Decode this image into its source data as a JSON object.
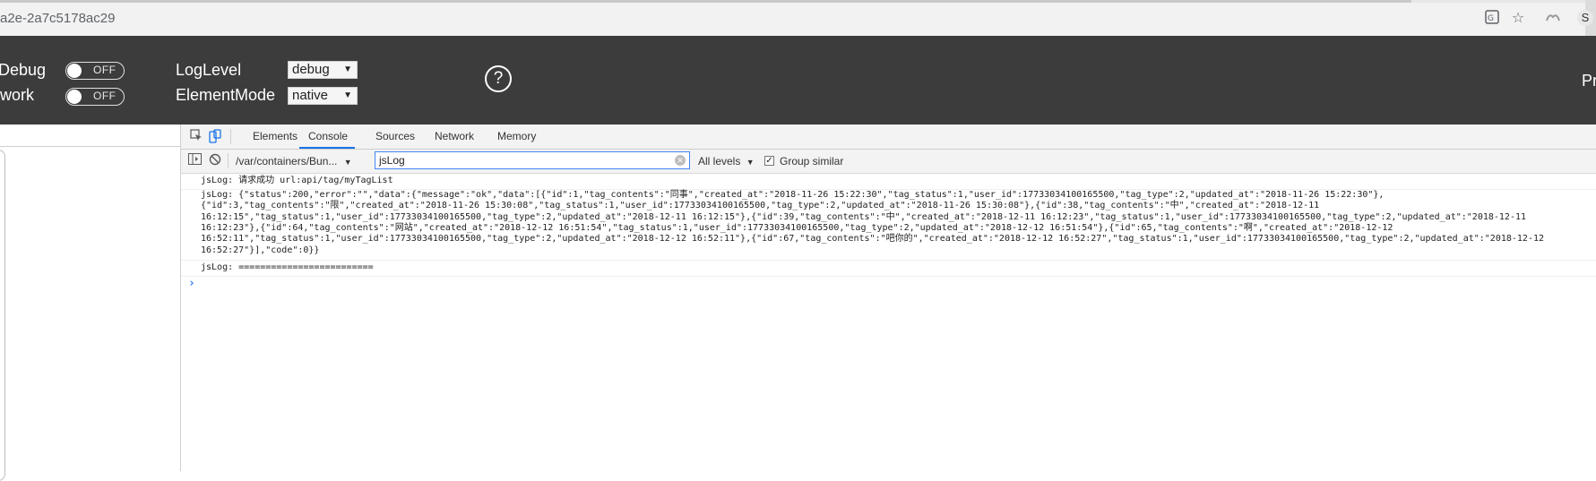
{
  "browser": {
    "url_fragment": "a2e-2a7c5178ac29",
    "ext_avatar_letter": "S",
    "icons": [
      "translate-icon",
      "star-icon",
      "extension-icon"
    ]
  },
  "toolbar": {
    "debug_label": "Debug",
    "network_label": "work",
    "debug_toggle": "OFF",
    "network_toggle": "OFF",
    "loglevel_label": "LogLevel",
    "loglevel_value": "debug",
    "elementmode_label": "ElementMode",
    "elementmode_value": "native",
    "help_symbol": "?",
    "right_text": "Pr"
  },
  "devtools": {
    "tabs": [
      "Elements",
      "Console",
      "Sources",
      "Network",
      "Memory"
    ],
    "active_tab": "Console",
    "context": "/var/containers/Bun...",
    "filter_value": "jsLog",
    "levels": "All levels",
    "group_similar": "Group similar",
    "group_similar_checked": true
  },
  "console": {
    "entries": [
      {
        "lines": [
          "jsLog: 请求成功 url:api/tag/myTagList"
        ]
      },
      {
        "lines": [
          "jsLog: {\"status\":200,\"error\":\"\",\"data\":{\"message\":\"ok\",\"data\":[{\"id\":1,\"tag_contents\":\"同事\",\"created_at\":\"2018-11-26 15:22:30\",\"tag_status\":1,\"user_id\":17733034100165500,\"tag_type\":2,\"updated_at\":\"2018-11-26 15:22:30\"},",
          "{\"id\":3,\"tag_contents\":\"限\",\"created_at\":\"2018-11-26 15:30:08\",\"tag_status\":1,\"user_id\":17733034100165500,\"tag_type\":2,\"updated_at\":\"2018-11-26 15:30:08\"},{\"id\":38,\"tag_contents\":\"中\",\"created_at\":\"2018-12-11",
          "16:12:15\",\"tag_status\":1,\"user_id\":17733034100165500,\"tag_type\":2,\"updated_at\":\"2018-12-11 16:12:15\"},{\"id\":39,\"tag_contents\":\"中\",\"created_at\":\"2018-12-11 16:12:23\",\"tag_status\":1,\"user_id\":17733034100165500,\"tag_type\":2,\"updated_at\":\"2018-12-11",
          "16:12:23\"},{\"id\":64,\"tag_contents\":\"网站\",\"created_at\":\"2018-12-12 16:51:54\",\"tag_status\":1,\"user_id\":17733034100165500,\"tag_type\":2,\"updated_at\":\"2018-12-12 16:51:54\"},{\"id\":65,\"tag_contents\":\"啊\",\"created_at\":\"2018-12-12",
          "16:52:11\",\"tag_status\":1,\"user_id\":17733034100165500,\"tag_type\":2,\"updated_at\":\"2018-12-12 16:52:11\"},{\"id\":67,\"tag_contents\":\"吧你的\",\"created_at\":\"2018-12-12 16:52:27\",\"tag_status\":1,\"user_id\":17733034100165500,\"tag_type\":2,\"updated_at\":\"2018-12-12",
          "16:52:27\"}],\"code\":0}}"
        ]
      },
      {
        "lines": [
          "jsLog: ========================="
        ]
      }
    ],
    "prompt_symbol": "›"
  }
}
